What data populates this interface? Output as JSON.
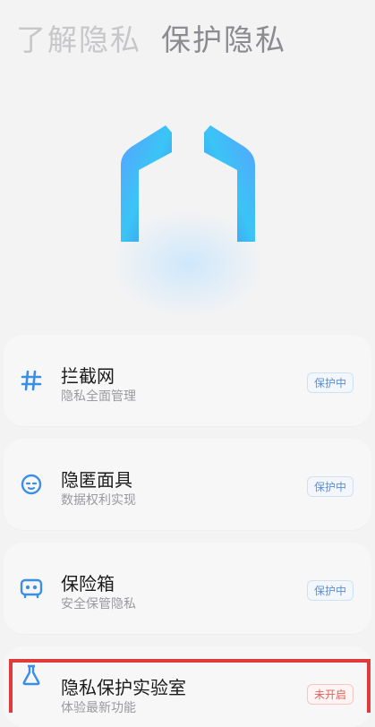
{
  "header": {
    "tab_learn": "了解隐私",
    "tab_protect": "保护隐私"
  },
  "items": [
    {
      "icon": "hash-icon",
      "title": "拦截网",
      "subtitle": "隐私全面管理",
      "status": "保护中"
    },
    {
      "icon": "mask-icon",
      "title": "隐匿面具",
      "subtitle": "数据权利实现",
      "status": "保护中"
    },
    {
      "icon": "safe-icon",
      "title": "保险箱",
      "subtitle": "安全保管隐私",
      "status": "保护中"
    },
    {
      "icon": "flask-icon",
      "title": "隐私保护实验室",
      "subtitle": "体验最新功能",
      "status": "未开启"
    }
  ],
  "colors": {
    "accent": "#3b8ee6",
    "badge_on": "#5b8fd1",
    "badge_off": "#e0625c",
    "highlight": "#e13a3a"
  }
}
